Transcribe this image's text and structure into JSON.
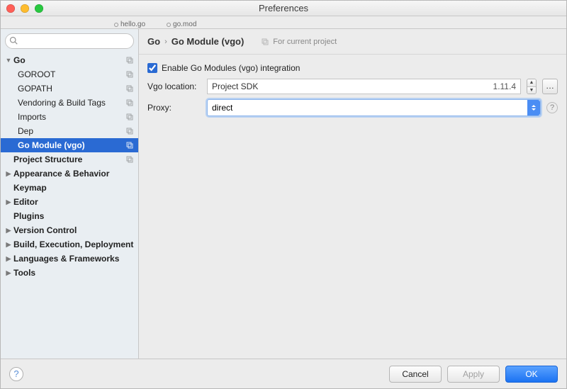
{
  "window": {
    "title": "Preferences"
  },
  "open_tabs": [
    "hello.go",
    "go.mod"
  ],
  "search": {
    "placeholder": ""
  },
  "tree": {
    "go": {
      "label": "Go",
      "items": [
        {
          "label": "GOROOT"
        },
        {
          "label": "GOPATH"
        },
        {
          "label": "Vendoring & Build Tags"
        },
        {
          "label": "Imports"
        },
        {
          "label": "Dep"
        },
        {
          "label": "Go Module (vgo)",
          "selected": true
        }
      ]
    },
    "project_structure": {
      "label": "Project Structure"
    },
    "groups": [
      {
        "label": "Appearance & Behavior"
      },
      {
        "label": "Keymap"
      },
      {
        "label": "Editor"
      },
      {
        "label": "Plugins"
      },
      {
        "label": "Version Control"
      },
      {
        "label": "Build, Execution, Deployment"
      },
      {
        "label": "Languages & Frameworks"
      },
      {
        "label": "Tools"
      }
    ]
  },
  "breadcrumb": {
    "root": "Go",
    "leaf": "Go Module (vgo)",
    "scope": "For current project"
  },
  "form": {
    "enable_label": "Enable Go Modules (vgo) integration",
    "enable_checked": true,
    "vgo_label": "Vgo location:",
    "vgo_value": "Project SDK",
    "vgo_version": "1.11.4",
    "proxy_label": "Proxy:",
    "proxy_value": "direct"
  },
  "footer": {
    "cancel": "Cancel",
    "apply": "Apply",
    "ok": "OK"
  }
}
